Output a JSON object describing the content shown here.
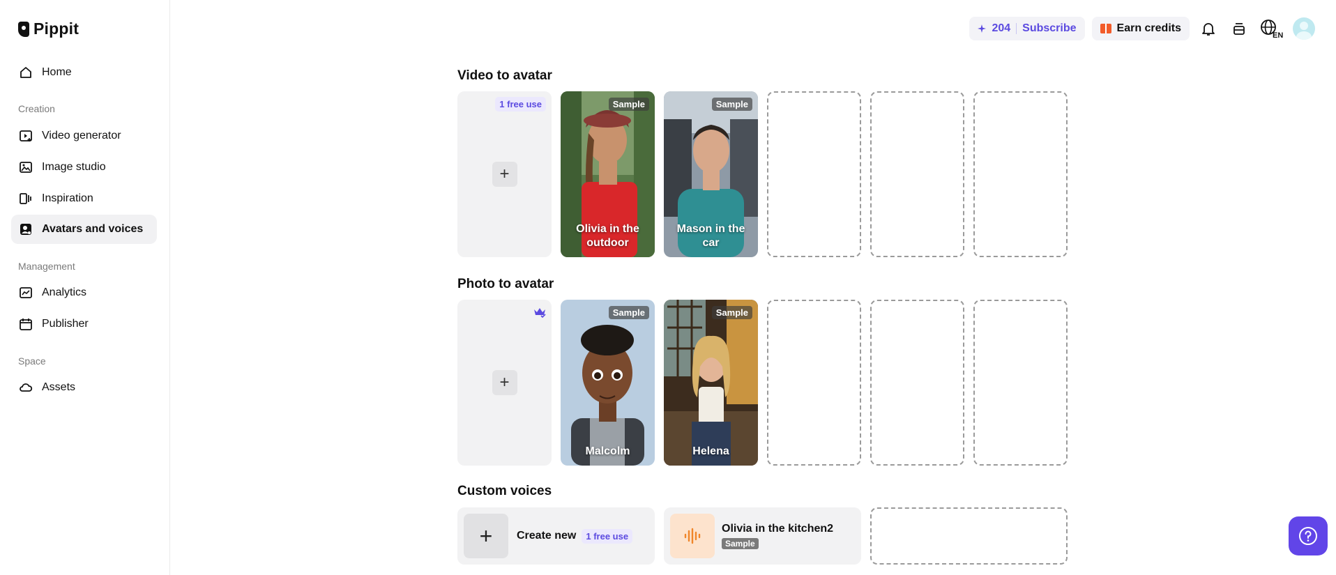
{
  "brand": {
    "name": "Pippit"
  },
  "sidebar": {
    "home": "Home",
    "section_creation": "Creation",
    "video_generator": "Video generator",
    "image_studio": "Image studio",
    "inspiration": "Inspiration",
    "avatars_voices": "Avatars and voices",
    "section_management": "Management",
    "analytics": "Analytics",
    "publisher": "Publisher",
    "section_space": "Space",
    "assets": "Assets"
  },
  "topbar": {
    "credits": "204",
    "subscribe": "Subscribe",
    "earn_credits": "Earn credits",
    "language": "EN"
  },
  "video_to_avatar": {
    "title": "Video to avatar",
    "free_tag": "1 free use",
    "cards": [
      {
        "name": "Olivia in the outdoor",
        "tag": "Sample"
      },
      {
        "name": "Mason in the car",
        "tag": "Sample"
      }
    ]
  },
  "photo_to_avatar": {
    "title": "Photo to avatar",
    "cards": [
      {
        "name": "Malcolm",
        "tag": "Sample"
      },
      {
        "name": "Helena",
        "tag": "Sample"
      }
    ]
  },
  "custom_voices": {
    "title": "Custom voices",
    "create_new": "Create new",
    "free_tag": "1 free use",
    "voice": {
      "name": "Olivia in the kitchen2",
      "tag": "Sample"
    }
  },
  "colors": {
    "accent": "#5b4ae0",
    "help_button": "#6145e8"
  }
}
